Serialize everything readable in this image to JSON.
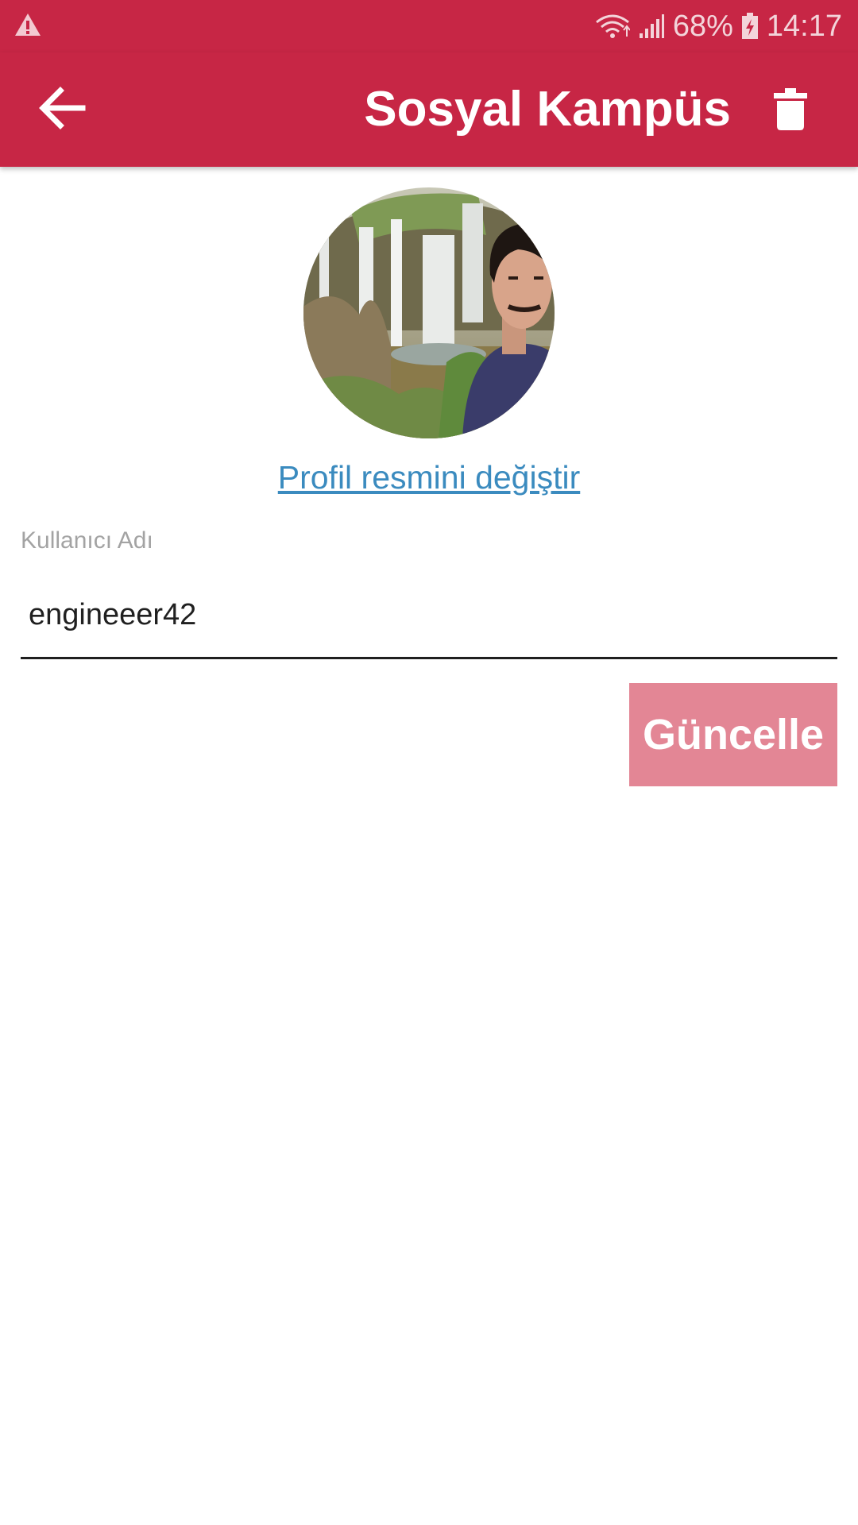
{
  "status_bar": {
    "battery": "68%",
    "time": "14:17",
    "icons": [
      "warning-icon",
      "wifi-icon",
      "signal-icon",
      "battery-charging-icon"
    ]
  },
  "app_bar": {
    "title": "Sosyal Kampüs",
    "back_icon": "arrow-left-icon",
    "delete_icon": "trash-icon"
  },
  "profile": {
    "avatar": "profile-photo",
    "change_photo_label": "Profil resmini değiştir"
  },
  "form": {
    "username_label": "Kullanıcı Adı",
    "username_value": "engineeer42",
    "update_label": "Güncelle"
  },
  "colors": {
    "primary": "#c72645",
    "button": "#e38695",
    "link": "#3b8bbf",
    "label": "#a3a3a3"
  }
}
